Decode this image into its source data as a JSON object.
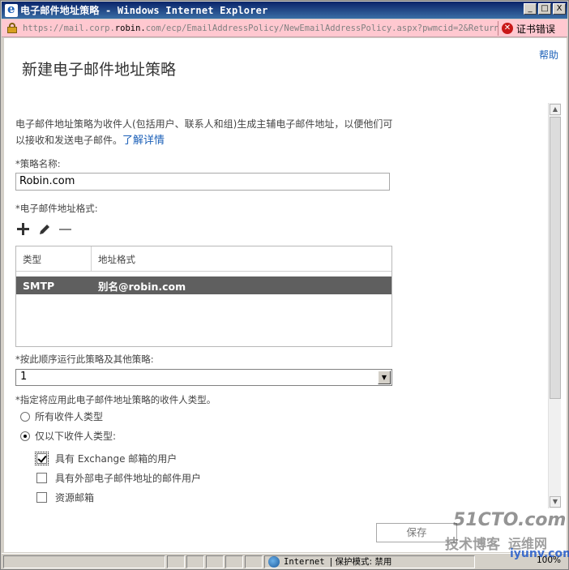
{
  "window": {
    "title": "电子邮件地址策略 - Windows Internet Explorer",
    "controls": {
      "minimize": "_",
      "maximize": "□",
      "close": "X"
    }
  },
  "address_bar": {
    "url_prefix": "https://mail.corp.",
    "url_host": "robin.",
    "url_rest": "com/ecp/EmailAddressPolicy/NewEmailAddressPolicy.aspx?pwmcid=2&ReturnObje",
    "cert_error": "证书错误"
  },
  "page": {
    "help": "帮助",
    "title": "新建电子邮件地址策略",
    "description": "电子邮件地址策略为收件人(包括用户、联系人和组)生成主辅电子邮件地址，以便他们可以接收和发送电子邮件。",
    "learn_more": "了解详情",
    "policy_name_label": "*策略名称:",
    "policy_name_value": "Robin.com",
    "format_label": "*电子邮件地址格式:",
    "table": {
      "columns": [
        "类型",
        "地址格式"
      ],
      "rows": [
        {
          "type": "SMTP",
          "format": "别名@robin.com"
        }
      ]
    },
    "order_label": "*按此顺序运行此策略及其他策略:",
    "order_value": "1",
    "recipient_label": "*指定将应用此电子邮件地址策略的收件人类型。",
    "radio_all": "所有收件人类型",
    "radio_only": "仅以下收件人类型:",
    "check_exchange": "具有 Exchange 邮箱的用户",
    "check_external": "具有外部电子邮件地址的邮件用户",
    "check_resource": "资源邮箱",
    "save": "保存"
  },
  "status_bar": {
    "zone": "Internet",
    "mode": "| 保护模式: 禁用",
    "zoom": "100%"
  },
  "watermark": {
    "line1": "51CTO.com",
    "line2": "技术博客",
    "line3": "运维网",
    "line4": "iyunv.com"
  }
}
